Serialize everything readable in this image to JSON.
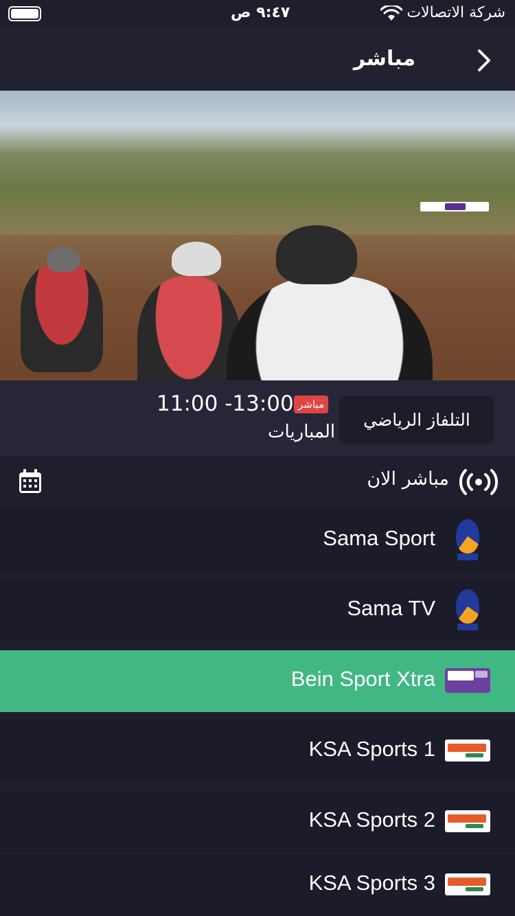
{
  "status_bar": {
    "time": "٩:٤٧ ص",
    "carrier": "شركة الاتصالات"
  },
  "header": {
    "title": "مباشر"
  },
  "program": {
    "category_button": "التلفاز الرياضي",
    "live_badge": "مباشر",
    "time_range": "11:00 -13:00",
    "title": "المباريات"
  },
  "section": {
    "title": "مباشر الان"
  },
  "channels": [
    {
      "name": "Sama Sport",
      "logo": "sama-logo",
      "active": false
    },
    {
      "name": "Sama TV",
      "logo": "sama-logo",
      "active": false
    },
    {
      "name": "Bein Sport Xtra",
      "logo": "bein-sports-xtra-logo",
      "active": true
    },
    {
      "name": "KSA Sports 1",
      "logo": "ksa-sports-logo",
      "active": false
    },
    {
      "name": "KSA Sports 2",
      "logo": "ksa-sports-logo",
      "active": false
    },
    {
      "name": "KSA Sports 3",
      "logo": "ksa-sports-logo",
      "active": false
    }
  ],
  "colors": {
    "background": "#1e1e2c",
    "active_row": "#41b883",
    "live_badge": "#e04545"
  }
}
